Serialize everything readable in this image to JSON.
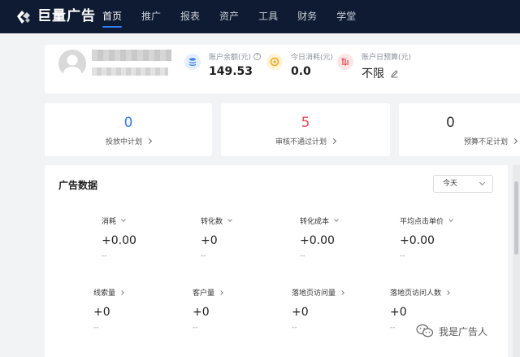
{
  "brand": {
    "name": "巨量广告"
  },
  "nav": {
    "items": [
      {
        "label": "首页",
        "active": true
      },
      {
        "label": "推广",
        "active": false
      },
      {
        "label": "报表",
        "active": false
      },
      {
        "label": "资产",
        "active": false
      },
      {
        "label": "工具",
        "active": false
      },
      {
        "label": "财务",
        "active": false
      },
      {
        "label": "学堂",
        "active": false
      }
    ]
  },
  "account": {
    "balance_label": "账户余额(元)",
    "balance_value": "149.53",
    "today_spend_label": "今日消耗(元)",
    "today_spend_value": "0.0",
    "daily_budget_label": "账户日预算(元)",
    "daily_budget_value": "不限"
  },
  "plans": [
    {
      "number": "0",
      "label": "投放中计划",
      "color": "#2f7cf6"
    },
    {
      "number": "5",
      "label": "审核不通过计划",
      "color": "#f04b57"
    },
    {
      "number": "0",
      "label": "预算不足计划",
      "color": "#333333"
    }
  ],
  "ad_data": {
    "title": "广告数据",
    "date_range": "今天",
    "metrics": [
      {
        "label": "消耗",
        "value": "+0.00",
        "sub": "--"
      },
      {
        "label": "转化数",
        "value": "+0",
        "sub": "--"
      },
      {
        "label": "转化成本",
        "value": "+0.00",
        "sub": "--"
      },
      {
        "label": "平均点击单价",
        "value": "+0.00",
        "sub": "--"
      },
      {
        "label": "线索量",
        "value": "+0",
        "sub": "--"
      },
      {
        "label": "客户量",
        "value": "+0",
        "sub": "--"
      },
      {
        "label": "落地页访问量",
        "value": "+0",
        "sub": "--"
      },
      {
        "label": "落地页访问人数",
        "value": "+0",
        "sub": "--"
      }
    ]
  },
  "watermark": {
    "text": "我是广告人"
  },
  "colors": {
    "nav_bg": "#0e1b33",
    "accent": "#2f7cf6",
    "danger": "#f04b57"
  },
  "icons": {
    "balance": "coin-stack-icon",
    "today_spend": "clock-coin-icon",
    "daily_budget": "budget-arrows-icon",
    "edit": "pencil-icon",
    "help": "question-circle-icon"
  }
}
